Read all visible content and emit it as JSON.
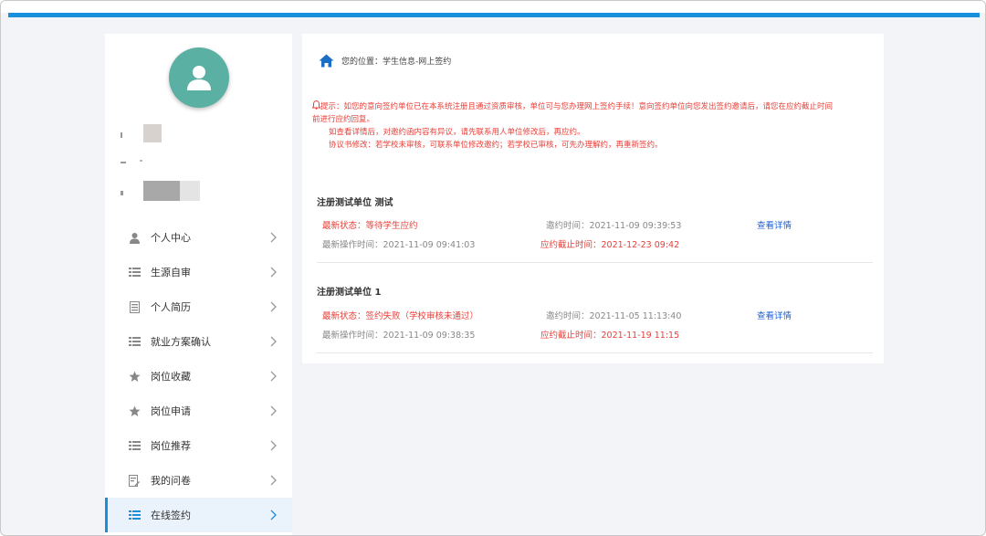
{
  "sidebar": {
    "items": [
      {
        "label": "个人中心",
        "icon": "user-icon"
      },
      {
        "label": "生源自审",
        "icon": "list-icon"
      },
      {
        "label": "个人简历",
        "icon": "document-icon"
      },
      {
        "label": "就业方案确认",
        "icon": "list-icon"
      },
      {
        "label": "岗位收藏",
        "icon": "star-icon"
      },
      {
        "label": "岗位申请",
        "icon": "star-icon"
      },
      {
        "label": "岗位推荐",
        "icon": "list-icon"
      },
      {
        "label": "我的问卷",
        "icon": "questionnaire-icon"
      },
      {
        "label": "在线签约",
        "icon": "list-icon",
        "active": true
      }
    ]
  },
  "breadcrumb": {
    "prefix": "您的位置：",
    "path": "学生信息-网上签约"
  },
  "notice": {
    "line1": "提示：如您的意向签约单位已在本系统注册且通过资质审核，单位可与您办理网上签约手续！意向签约单位向您发出签约邀请后，请您在应约截止时间",
    "line2": "前进行应约回复。",
    "line3": "如查看详情后，对邀约函内容有异议，请先联系用人单位修改后，再应约。",
    "line4": "协议书修改：若学校未审核，可联系单位修改邀约；若学校已审核，可先办理解约，再重新签约。"
  },
  "records": [
    {
      "title": "注册测试单位 测试",
      "status": "最新状态：等待学生应约",
      "invite_time": "邀约时间：2021-11-09 09:39:53",
      "detail_link": "查看详情",
      "op_time": "最新操作时间：2021-11-09 09:41:03",
      "deadline": "应约截止时间：2021-12-23 09:42"
    },
    {
      "title": "注册测试单位 1",
      "status": "最新状态：签约失败（学校审核未通过）",
      "invite_time": "邀约时间：2021-11-05 11:13:40",
      "detail_link": "查看详情",
      "op_time": "最新操作时间：2021-11-09 09:38:35",
      "deadline": "应约截止时间：2021-11-19 11:15"
    }
  ],
  "colors": {
    "accent": "#1a8fdc",
    "avatar_bg": "#5ab0a2",
    "alert": "#e8403a",
    "link": "#1c5fd8"
  }
}
